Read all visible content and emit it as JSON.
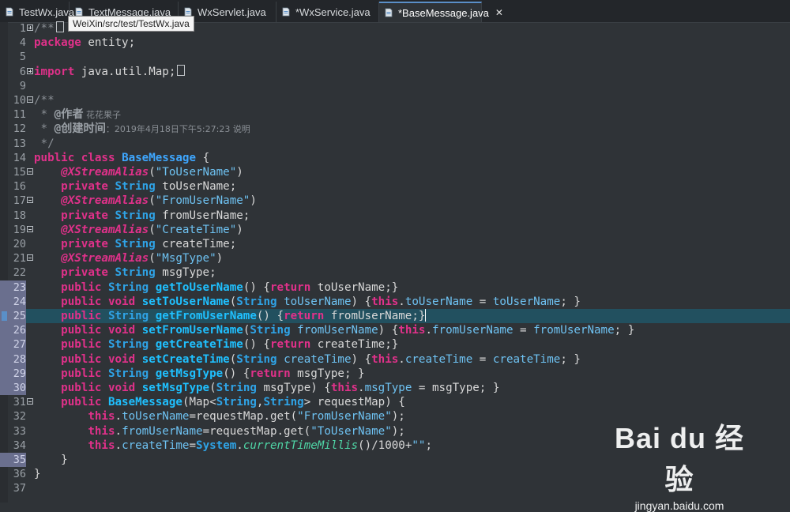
{
  "tabs": [
    {
      "label": "TestWx.java",
      "active": false
    },
    {
      "label": "TextMessage.java",
      "active": false
    },
    {
      "label": "WxServlet.java",
      "active": false
    },
    {
      "label": "*WxService.java",
      "active": false
    },
    {
      "label": "*BaseMessage.java",
      "active": true
    }
  ],
  "tooltip": "WeiXin/src/test/TestWx.java",
  "close_glyph": "✕",
  "watermark": {
    "logo": "Bai du 经验",
    "url": "jingyan.baidu.com"
  },
  "lines": [
    {
      "n": "1",
      "tokens": [
        {
          "t": "/**",
          "c": "cm"
        }
      ]
    },
    {
      "n": "4",
      "tokens": [
        {
          "t": "package",
          "c": "kw"
        },
        {
          "t": " entity;",
          "c": "pl"
        }
      ]
    },
    {
      "n": "5",
      "tokens": []
    },
    {
      "n": "6",
      "tokens": [
        {
          "t": "import",
          "c": "kw"
        },
        {
          "t": " java.util.Map;",
          "c": "pl"
        }
      ]
    },
    {
      "n": "9",
      "tokens": []
    },
    {
      "n": "10",
      "tokens": [
        {
          "t": "/**",
          "c": "cm"
        }
      ]
    },
    {
      "n": "11",
      "tokens": [
        {
          "t": " * ",
          "c": "cm"
        },
        {
          "t": "@作者",
          "c": "jd"
        },
        {
          "t": " 花花果子",
          "c": "cjk"
        }
      ]
    },
    {
      "n": "12",
      "tokens": [
        {
          "t": " * ",
          "c": "cm"
        },
        {
          "t": "@创建时间",
          "c": "jd"
        },
        {
          "t": "：2019年4月18日下午5:27:23 说明",
          "c": "cjk"
        }
      ]
    },
    {
      "n": "13",
      "tokens": [
        {
          "t": " */",
          "c": "cm"
        }
      ]
    },
    {
      "n": "14",
      "tokens": [
        {
          "t": "public",
          "c": "kw"
        },
        {
          "t": " ",
          "c": "pl"
        },
        {
          "t": "class",
          "c": "kw"
        },
        {
          "t": " ",
          "c": "pl"
        },
        {
          "t": "BaseMessage",
          "c": "cl"
        },
        {
          "t": " {",
          "c": "pl"
        }
      ]
    },
    {
      "n": "15",
      "tokens": [
        {
          "t": "    ",
          "c": "pl"
        },
        {
          "t": "@XStreamAlias",
          "c": "an"
        },
        {
          "t": "(",
          "c": "pl"
        },
        {
          "t": "\"ToUserName\"",
          "c": "st"
        },
        {
          "t": ")",
          "c": "pl"
        }
      ]
    },
    {
      "n": "16",
      "tokens": [
        {
          "t": "    ",
          "c": "pl"
        },
        {
          "t": "private",
          "c": "kw"
        },
        {
          "t": " ",
          "c": "pl"
        },
        {
          "t": "String",
          "c": "ty"
        },
        {
          "t": " toUserName;",
          "c": "pl"
        }
      ]
    },
    {
      "n": "17",
      "tokens": [
        {
          "t": "    ",
          "c": "pl"
        },
        {
          "t": "@XStreamAlias",
          "c": "an"
        },
        {
          "t": "(",
          "c": "pl"
        },
        {
          "t": "\"FromUserName\"",
          "c": "st"
        },
        {
          "t": ")",
          "c": "pl"
        }
      ]
    },
    {
      "n": "18",
      "tokens": [
        {
          "t": "    ",
          "c": "pl"
        },
        {
          "t": "private",
          "c": "kw"
        },
        {
          "t": " ",
          "c": "pl"
        },
        {
          "t": "String",
          "c": "ty"
        },
        {
          "t": " fromUserName;",
          "c": "pl"
        }
      ]
    },
    {
      "n": "19",
      "tokens": [
        {
          "t": "    ",
          "c": "pl"
        },
        {
          "t": "@XStreamAlias",
          "c": "an"
        },
        {
          "t": "(",
          "c": "pl"
        },
        {
          "t": "\"CreateTime\"",
          "c": "st"
        },
        {
          "t": ")",
          "c": "pl"
        }
      ]
    },
    {
      "n": "20",
      "tokens": [
        {
          "t": "    ",
          "c": "pl"
        },
        {
          "t": "private",
          "c": "kw"
        },
        {
          "t": " ",
          "c": "pl"
        },
        {
          "t": "String",
          "c": "ty"
        },
        {
          "t": " createTime;",
          "c": "pl"
        }
      ]
    },
    {
      "n": "21",
      "tokens": [
        {
          "t": "    ",
          "c": "pl"
        },
        {
          "t": "@XStreamAlias",
          "c": "an"
        },
        {
          "t": "(",
          "c": "pl"
        },
        {
          "t": "\"MsgType\"",
          "c": "st"
        },
        {
          "t": ")",
          "c": "pl"
        }
      ]
    },
    {
      "n": "22",
      "tokens": [
        {
          "t": "    ",
          "c": "pl"
        },
        {
          "t": "private",
          "c": "kw"
        },
        {
          "t": " ",
          "c": "pl"
        },
        {
          "t": "String",
          "c": "ty"
        },
        {
          "t": " msgType;",
          "c": "pl"
        }
      ]
    },
    {
      "n": "23",
      "tokens": [
        {
          "t": "    ",
          "c": "pl"
        },
        {
          "t": "public",
          "c": "kw"
        },
        {
          "t": " ",
          "c": "pl"
        },
        {
          "t": "String",
          "c": "ty"
        },
        {
          "t": " ",
          "c": "pl"
        },
        {
          "t": "getToUserName",
          "c": "mt"
        },
        {
          "t": "() {",
          "c": "pl"
        },
        {
          "t": "return",
          "c": "kw"
        },
        {
          "t": " toUserName;}",
          "c": "pl"
        }
      ]
    },
    {
      "n": "24",
      "tokens": [
        {
          "t": "    ",
          "c": "pl"
        },
        {
          "t": "public",
          "c": "kw"
        },
        {
          "t": " ",
          "c": "pl"
        },
        {
          "t": "void",
          "c": "kw"
        },
        {
          "t": " ",
          "c": "pl"
        },
        {
          "t": "setToUserName",
          "c": "mt"
        },
        {
          "t": "(",
          "c": "pl"
        },
        {
          "t": "String",
          "c": "ty"
        },
        {
          "t": " ",
          "c": "pl"
        },
        {
          "t": "toUserName",
          "c": "fl"
        },
        {
          "t": ") {",
          "c": "pl"
        },
        {
          "t": "this",
          "c": "kw"
        },
        {
          "t": ".",
          "c": "pl"
        },
        {
          "t": "toUserName",
          "c": "fl"
        },
        {
          "t": " = ",
          "c": "pl"
        },
        {
          "t": "toUserName",
          "c": "fl"
        },
        {
          "t": "; }",
          "c": "pl"
        }
      ]
    },
    {
      "n": "25",
      "tokens": [
        {
          "t": "    ",
          "c": "pl"
        },
        {
          "t": "public",
          "c": "kw"
        },
        {
          "t": " ",
          "c": "pl"
        },
        {
          "t": "String",
          "c": "ty"
        },
        {
          "t": " ",
          "c": "pl"
        },
        {
          "t": "getFromUserName",
          "c": "mt"
        },
        {
          "t": "() {",
          "c": "pl"
        },
        {
          "t": "return",
          "c": "kw"
        },
        {
          "t": " fromUserName;}",
          "c": "pl"
        }
      ]
    },
    {
      "n": "26",
      "tokens": [
        {
          "t": "    ",
          "c": "pl"
        },
        {
          "t": "public",
          "c": "kw"
        },
        {
          "t": " ",
          "c": "pl"
        },
        {
          "t": "void",
          "c": "kw"
        },
        {
          "t": " ",
          "c": "pl"
        },
        {
          "t": "setFromUserName",
          "c": "mt"
        },
        {
          "t": "(",
          "c": "pl"
        },
        {
          "t": "String",
          "c": "ty"
        },
        {
          "t": " ",
          "c": "pl"
        },
        {
          "t": "fromUserName",
          "c": "fl"
        },
        {
          "t": ") {",
          "c": "pl"
        },
        {
          "t": "this",
          "c": "kw"
        },
        {
          "t": ".",
          "c": "pl"
        },
        {
          "t": "fromUserName",
          "c": "fl"
        },
        {
          "t": " = ",
          "c": "pl"
        },
        {
          "t": "fromUserName",
          "c": "fl"
        },
        {
          "t": "; }",
          "c": "pl"
        }
      ]
    },
    {
      "n": "27",
      "tokens": [
        {
          "t": "    ",
          "c": "pl"
        },
        {
          "t": "public",
          "c": "kw"
        },
        {
          "t": " ",
          "c": "pl"
        },
        {
          "t": "String",
          "c": "ty"
        },
        {
          "t": " ",
          "c": "pl"
        },
        {
          "t": "getCreateTime",
          "c": "mt"
        },
        {
          "t": "() {",
          "c": "pl"
        },
        {
          "t": "return",
          "c": "kw"
        },
        {
          "t": " createTime;}",
          "c": "pl"
        }
      ]
    },
    {
      "n": "28",
      "tokens": [
        {
          "t": "    ",
          "c": "pl"
        },
        {
          "t": "public",
          "c": "kw"
        },
        {
          "t": " ",
          "c": "pl"
        },
        {
          "t": "void",
          "c": "kw"
        },
        {
          "t": " ",
          "c": "pl"
        },
        {
          "t": "setCreateTime",
          "c": "mt"
        },
        {
          "t": "(",
          "c": "pl"
        },
        {
          "t": "String",
          "c": "ty"
        },
        {
          "t": " ",
          "c": "pl"
        },
        {
          "t": "createTime",
          "c": "fl"
        },
        {
          "t": ") {",
          "c": "pl"
        },
        {
          "t": "this",
          "c": "kw"
        },
        {
          "t": ".",
          "c": "pl"
        },
        {
          "t": "createTime",
          "c": "fl"
        },
        {
          "t": " = ",
          "c": "pl"
        },
        {
          "t": "createTime",
          "c": "fl"
        },
        {
          "t": "; }",
          "c": "pl"
        }
      ]
    },
    {
      "n": "29",
      "tokens": [
        {
          "t": "    ",
          "c": "pl"
        },
        {
          "t": "public",
          "c": "kw"
        },
        {
          "t": " ",
          "c": "pl"
        },
        {
          "t": "String",
          "c": "ty"
        },
        {
          "t": " ",
          "c": "pl"
        },
        {
          "t": "getMsgType",
          "c": "mt"
        },
        {
          "t": "() {",
          "c": "pl"
        },
        {
          "t": "return",
          "c": "kw"
        },
        {
          "t": " msgType; }",
          "c": "pl"
        }
      ]
    },
    {
      "n": "30",
      "tokens": [
        {
          "t": "    ",
          "c": "pl"
        },
        {
          "t": "public",
          "c": "kw"
        },
        {
          "t": " ",
          "c": "pl"
        },
        {
          "t": "void",
          "c": "kw"
        },
        {
          "t": " ",
          "c": "pl"
        },
        {
          "t": "setMsgType",
          "c": "mt"
        },
        {
          "t": "(",
          "c": "pl"
        },
        {
          "t": "String",
          "c": "ty"
        },
        {
          "t": " msgType) {",
          "c": "pl"
        },
        {
          "t": "this",
          "c": "kw"
        },
        {
          "t": ".",
          "c": "pl"
        },
        {
          "t": "msgType",
          "c": "fl"
        },
        {
          "t": " = msgType; }",
          "c": "pl"
        }
      ]
    },
    {
      "n": "31",
      "tokens": [
        {
          "t": "    ",
          "c": "pl"
        },
        {
          "t": "public",
          "c": "kw"
        },
        {
          "t": " ",
          "c": "pl"
        },
        {
          "t": "BaseMessage",
          "c": "mt"
        },
        {
          "t": "(Map<",
          "c": "pl"
        },
        {
          "t": "String",
          "c": "ty"
        },
        {
          "t": ",",
          "c": "pl"
        },
        {
          "t": "String",
          "c": "ty"
        },
        {
          "t": "> requestMap) {",
          "c": "pl"
        }
      ]
    },
    {
      "n": "32",
      "tokens": [
        {
          "t": "        ",
          "c": "pl"
        },
        {
          "t": "this",
          "c": "kw"
        },
        {
          "t": ".",
          "c": "pl"
        },
        {
          "t": "toUserName",
          "c": "fl"
        },
        {
          "t": "=requestMap.get(",
          "c": "pl"
        },
        {
          "t": "\"FromUserName\"",
          "c": "st"
        },
        {
          "t": ");",
          "c": "pl"
        }
      ]
    },
    {
      "n": "33",
      "tokens": [
        {
          "t": "        ",
          "c": "pl"
        },
        {
          "t": "this",
          "c": "kw"
        },
        {
          "t": ".",
          "c": "pl"
        },
        {
          "t": "fromUserName",
          "c": "fl"
        },
        {
          "t": "=requestMap.get(",
          "c": "pl"
        },
        {
          "t": "\"ToUserName\"",
          "c": "st"
        },
        {
          "t": ");",
          "c": "pl"
        }
      ]
    },
    {
      "n": "34",
      "tokens": [
        {
          "t": "        ",
          "c": "pl"
        },
        {
          "t": "this",
          "c": "kw"
        },
        {
          "t": ".",
          "c": "pl"
        },
        {
          "t": "createTime",
          "c": "fl"
        },
        {
          "t": "=",
          "c": "pl"
        },
        {
          "t": "System",
          "c": "ty"
        },
        {
          "t": ".",
          "c": "pl"
        },
        {
          "t": "currentTimeMillis",
          "c": "sm"
        },
        {
          "t": "()/1000+",
          "c": "pl"
        },
        {
          "t": "\"\"",
          "c": "st"
        },
        {
          "t": ";",
          "c": "pl"
        }
      ]
    },
    {
      "n": "35",
      "tokens": [
        {
          "t": "    }",
          "c": "pl"
        }
      ]
    },
    {
      "n": "36",
      "tokens": [
        {
          "t": "}",
          "c": "pl"
        }
      ]
    },
    {
      "n": "37",
      "tokens": []
    }
  ]
}
